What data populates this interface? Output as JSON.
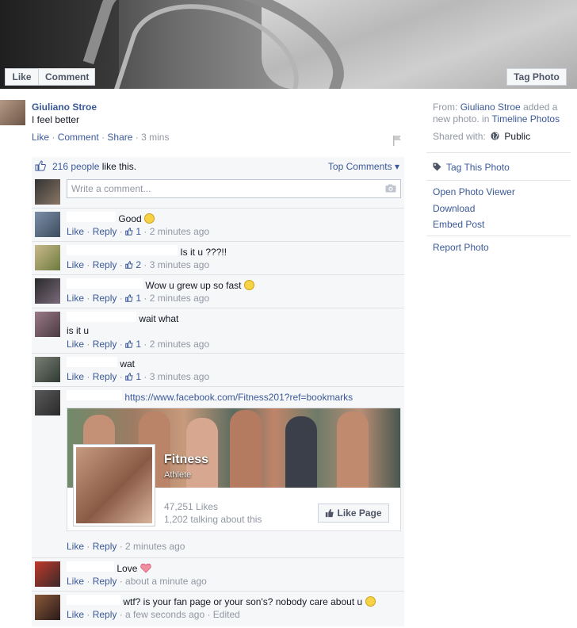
{
  "photo": {
    "like_label": "Like",
    "comment_label": "Comment",
    "tag_label": "Tag Photo"
  },
  "post": {
    "author": "Giuliano Stroe",
    "status": "I feel better",
    "actions": {
      "like": "Like",
      "comment": "Comment",
      "share": "Share",
      "time": "3 mins"
    }
  },
  "likes": {
    "count_text": "216 people",
    "suffix": "like this.",
    "top_comments": "Top Comments"
  },
  "compose": {
    "placeholder": "Write a comment..."
  },
  "comments": [
    {
      "text": "Good",
      "emoji": "smile",
      "like": "Like",
      "reply": "Reply",
      "likes": "1",
      "time": "2 minutes ago"
    },
    {
      "text": "Is it u ???!!",
      "emoji": "",
      "like": "Like",
      "reply": "Reply",
      "likes": "2",
      "time": "3 minutes ago"
    },
    {
      "text": "Wow u grew up so fast",
      "emoji": "surprised",
      "like": "Like",
      "reply": "Reply",
      "likes": "1",
      "time": "2 minutes ago"
    },
    {
      "text": "wait what",
      "text2": "is it u",
      "emoji": "",
      "like": "Like",
      "reply": "Reply",
      "likes": "1",
      "time": "2 minutes ago"
    },
    {
      "text": "wat",
      "emoji": "",
      "like": "Like",
      "reply": "Reply",
      "likes": "1",
      "time": "3 minutes ago"
    },
    {
      "text": "https://www.facebook.com/Fitness201?ref=bookmarks",
      "like": "Like",
      "reply": "Reply",
      "time": "2 minutes ago",
      "card": {
        "title": "Fitness",
        "subtitle": "Athlete",
        "likes": "47,251 Likes",
        "talking": "1,202 talking about this",
        "button": "Like Page"
      }
    },
    {
      "text": "Love",
      "emoji": "heart",
      "like": "Like",
      "reply": "Reply",
      "time": "about a minute ago"
    },
    {
      "text": "wtf? is your fan page or your son's? nobody care about u",
      "emoji": "unamused",
      "like": "Like",
      "reply": "Reply",
      "time": "a few seconds ago",
      "edited": "Edited"
    }
  ],
  "sidebar": {
    "from_label": "From:",
    "from_author": "Giuliano Stroe",
    "from_action": "added a new photo. in",
    "from_album": "Timeline Photos",
    "shared_label": "Shared with:",
    "shared_value": "Public",
    "tag_photo": "Tag This Photo",
    "open_viewer": "Open Photo Viewer",
    "download": "Download",
    "embed": "Embed Post",
    "report": "Report Photo"
  }
}
